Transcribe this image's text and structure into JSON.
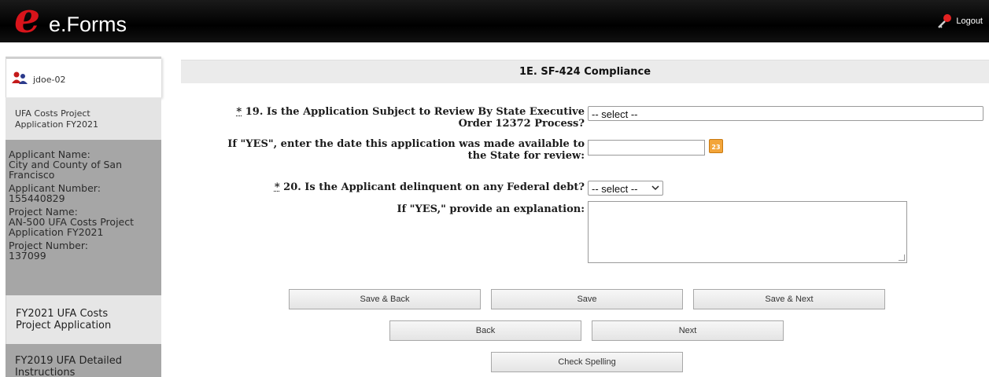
{
  "header": {
    "logo_e": "e",
    "logo_text": "e.Forms",
    "logout_label": "Logout",
    "logout_icon": "key-icon"
  },
  "sidebar": {
    "user": "jdoe-02",
    "user_icon": "user-icon",
    "project_link": [
      "UFA Costs Project",
      "Application FY2021"
    ],
    "info": [
      "Applicant Name:",
      "City and County of San",
      "Francisco",
      "Applicant Number:",
      "155440829",
      "Project Name:",
      "AN-500 UFA Costs Project",
      "Application FY2021",
      "Project Number:",
      "137099"
    ],
    "application_link": [
      "FY2021 UFA Costs",
      "Project Application"
    ],
    "instructions_link": [
      "FY2019 UFA Detailed",
      "Instructions"
    ]
  },
  "main": {
    "title": "1E. SF-424 Compliance",
    "q19": {
      "required_mark": "*",
      "label_line1": " 19. Is the Application Subject to Review By State Executive",
      "label_line2": "Order 12372 Process?",
      "select_value": "-- select --"
    },
    "q19_date": {
      "label_line1": "If \"YES\", enter the date this application was made available to",
      "label_line2": "the State for review:",
      "calendar_text": "23"
    },
    "q20": {
      "required_mark": "*",
      "label": " 20. Is the Applicant delinquent on any Federal debt?",
      "select_value": "-- select --"
    },
    "q20_explain": {
      "label": "If \"YES,\" provide an explanation:"
    },
    "buttons": {
      "save_back": "Save & Back",
      "save": "Save",
      "save_next": "Save & Next",
      "back": "Back",
      "next": "Next",
      "check_spelling": "Check Spelling"
    }
  }
}
